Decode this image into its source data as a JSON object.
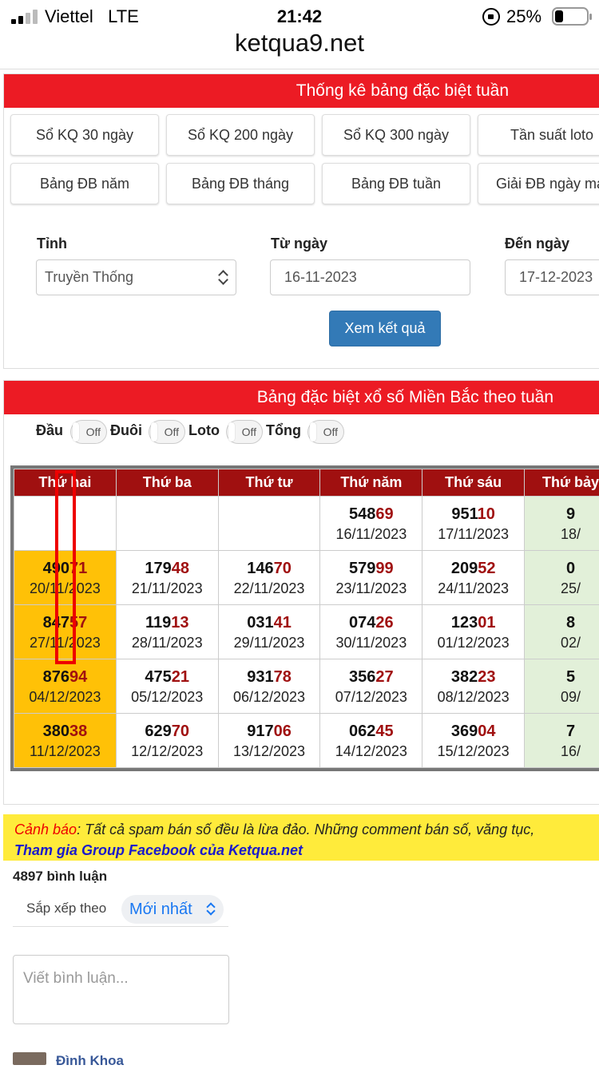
{
  "status": {
    "carrier": "Viettel",
    "network": "LTE",
    "time": "21:42",
    "battery": "25%",
    "battery_level": 0.25
  },
  "browser": {
    "url": "ketqua9.net"
  },
  "panel1": {
    "title": "Thống kê bảng đặc biệt tuần",
    "buttons_row1": [
      "Sổ KQ 30 ngày",
      "Sổ KQ 200 ngày",
      "Sổ KQ 300 ngày",
      "Tần suất loto"
    ],
    "buttons_row2": [
      "Bảng ĐB năm",
      "Bảng ĐB tháng",
      "Bảng ĐB tuần",
      "Giải ĐB ngày mai"
    ],
    "form": {
      "province_label": "Tỉnh",
      "province_value": "Truyền Thống",
      "from_label": "Từ ngày",
      "from_value": "16-11-2023",
      "to_label": "Đến ngày",
      "to_value": "17-12-2023",
      "submit": "Xem kết quả"
    }
  },
  "panel2": {
    "title": "Bảng đặc biệt xổ số Miền Bắc theo tuần",
    "toggles": [
      {
        "label": "Đầu",
        "state": "Off"
      },
      {
        "label": "Đuôi",
        "state": "Off"
      },
      {
        "label": "Loto",
        "state": "Off"
      },
      {
        "label": "Tổng",
        "state": "Off"
      }
    ],
    "headers": [
      "Thứ hai",
      "Thứ ba",
      "Thứ tư",
      "Thứ năm",
      "Thứ sáu",
      "Thứ bảy"
    ],
    "rows": [
      [
        {
          "head": "",
          "tail": "",
          "date": ""
        },
        {
          "head": "",
          "tail": "",
          "date": ""
        },
        {
          "head": "",
          "tail": "",
          "date": ""
        },
        {
          "head": "548",
          "tail": "69",
          "date": "16/11/2023"
        },
        {
          "head": "951",
          "tail": "10",
          "date": "17/11/2023"
        },
        {
          "head": "9",
          "tail": "",
          "date": "18/"
        }
      ],
      [
        {
          "head": "490",
          "tail": "71",
          "date": "20/11/2023"
        },
        {
          "head": "179",
          "tail": "48",
          "date": "21/11/2023"
        },
        {
          "head": "146",
          "tail": "70",
          "date": "22/11/2023"
        },
        {
          "head": "579",
          "tail": "99",
          "date": "23/11/2023"
        },
        {
          "head": "209",
          "tail": "52",
          "date": "24/11/2023"
        },
        {
          "head": "0",
          "tail": "",
          "date": "25/"
        }
      ],
      [
        {
          "head": "847",
          "tail": "57",
          "date": "27/11/2023"
        },
        {
          "head": "119",
          "tail": "13",
          "date": "28/11/2023"
        },
        {
          "head": "031",
          "tail": "41",
          "date": "29/11/2023"
        },
        {
          "head": "074",
          "tail": "26",
          "date": "30/11/2023"
        },
        {
          "head": "123",
          "tail": "01",
          "date": "01/12/2023"
        },
        {
          "head": "8",
          "tail": "",
          "date": "02/"
        }
      ],
      [
        {
          "head": "876",
          "tail": "94",
          "date": "04/12/2023"
        },
        {
          "head": "475",
          "tail": "21",
          "date": "05/12/2023"
        },
        {
          "head": "931",
          "tail": "78",
          "date": "06/12/2023"
        },
        {
          "head": "356",
          "tail": "27",
          "date": "07/12/2023"
        },
        {
          "head": "382",
          "tail": "23",
          "date": "08/12/2023"
        },
        {
          "head": "5",
          "tail": "",
          "date": "09/"
        }
      ],
      [
        {
          "head": "380",
          "tail": "38",
          "date": "11/12/2023"
        },
        {
          "head": "629",
          "tail": "70",
          "date": "12/12/2023"
        },
        {
          "head": "917",
          "tail": "06",
          "date": "13/12/2023"
        },
        {
          "head": "062",
          "tail": "45",
          "date": "14/12/2023"
        },
        {
          "head": "369",
          "tail": "04",
          "date": "15/12/2023"
        },
        {
          "head": "7",
          "tail": "",
          "date": "16/"
        }
      ]
    ]
  },
  "warning": {
    "label": "Cảnh báo",
    "text": ": Tất cả spam bán số đều là lừa đảo. Những comment bán số, văng tục, ",
    "link": "Tham gia Group Facebook của Ketqua.net"
  },
  "comments": {
    "count": "4897 bình luận",
    "sort_label": "Sắp xếp theo",
    "sort_value": "Mới nhất",
    "placeholder": "Viết bình luận...",
    "first_user": "Đình Khoa"
  },
  "colors": {
    "header_red": "#ec1b24",
    "table_header": "#a01010",
    "monday_highlight": "#ffc107",
    "saturday_bg": "#e2f0d9",
    "button_blue": "#337ab7"
  }
}
